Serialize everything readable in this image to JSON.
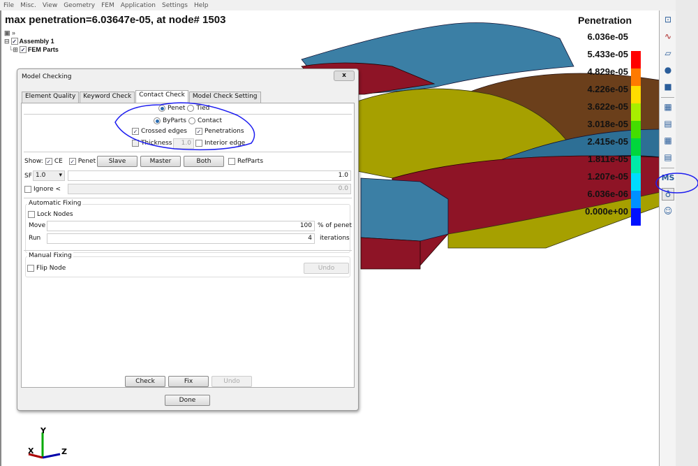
{
  "menu": [
    "File",
    "Misc.",
    "View",
    "Geometry",
    "FEM",
    "Application",
    "Settings",
    "Help"
  ],
  "viewport": {
    "title": "max penetration=6.03647e-05, at node# 1503",
    "tree": {
      "root": "Assembly 1",
      "child": "FEM Parts"
    },
    "axes": {
      "x": "X",
      "y": "Y",
      "z": "Z"
    }
  },
  "legend": {
    "title": "Penetration",
    "labels": [
      "6.036e-05",
      "5.433e-05",
      "4.829e-05",
      "4.226e-05",
      "3.622e-05",
      "3.018e-05",
      "2.415e-05",
      "1.811e-05",
      "1.207e-05",
      "6.036e-06",
      "0.000e+00"
    ],
    "colors": [
      "#ff0000",
      "#ff7a00",
      "#ffdd00",
      "#a8ee00",
      "#44dd00",
      "#00d63c",
      "#00eaa8",
      "#00dcff",
      "#0090ff",
      "#0010ff"
    ]
  },
  "toolbar": {
    "ms_label": "MS",
    "icons": [
      "move-icon",
      "curve-icon",
      "surface-icon",
      "solid-icon",
      "part-icon",
      "mesh-icon",
      "mesh-table-icon",
      "mesh-edit-icon",
      "element-table-icon",
      "model-check-icon",
      "user-icon"
    ]
  },
  "dialog": {
    "title": "Model Checking",
    "close": "x",
    "tabs": [
      "Element Quality",
      "Keyword Check",
      "Contact Check",
      "Model Check Setting"
    ],
    "penet": "Penet",
    "tied": "Tied",
    "byparts": "ByParts",
    "contact": "Contact",
    "crossed_edges": "Crossed edges",
    "penetrations": "Penetrations",
    "thickness": "Thickness",
    "thickness_value": "1.0",
    "interior_edge": "Interior edge",
    "show": "Show:",
    "ce": "CE",
    "show_penet": "Penet",
    "slave": "Slave",
    "master": "Master",
    "both": "Both",
    "refparts": "RefParts",
    "sf": "SF",
    "sf_select": "1.0",
    "sf_value": "1.0",
    "ignore": "Ignore <",
    "ignore_value": "0.0",
    "auto_fixing": "Automatic Fixing",
    "lock_nodes": "Lock Nodes",
    "move": "Move",
    "move_value": "100",
    "move_unit": "% of penet",
    "run": "Run",
    "run_value": "4",
    "run_unit": "iterations",
    "manual_fixing": "Manual Fixing",
    "flip_node": "Flip Node",
    "undo_manual": "Undo",
    "check": "Check",
    "fix": "Fix",
    "undo": "Undo",
    "done": "Done"
  }
}
